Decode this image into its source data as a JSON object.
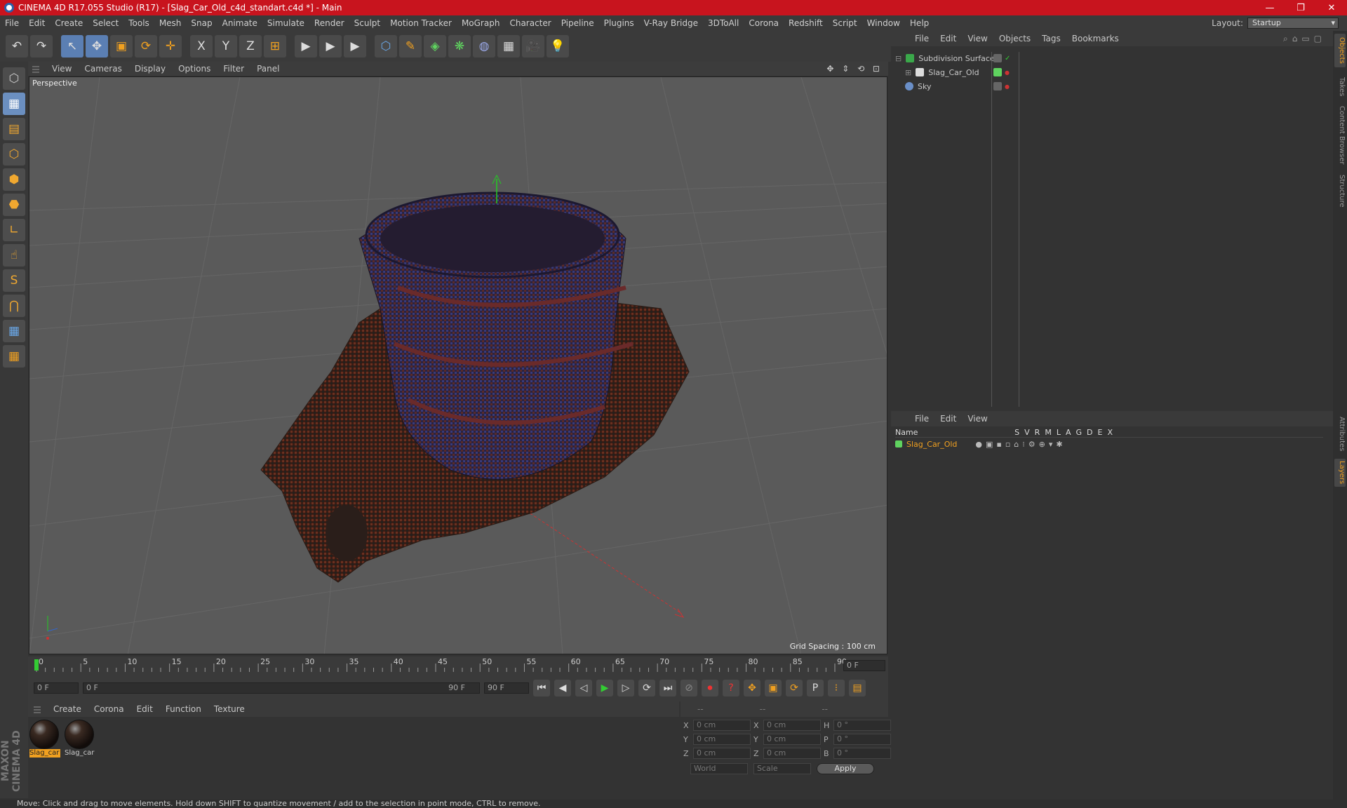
{
  "title_bar": {
    "title": "CINEMA 4D R17.055 Studio (R17) - [Slag_Car_Old_c4d_standart.c4d *] - Main",
    "minimize": "—",
    "maximize": "❐",
    "close": "✕"
  },
  "menu": [
    "File",
    "Edit",
    "Create",
    "Select",
    "Tools",
    "Mesh",
    "Snap",
    "Animate",
    "Simulate",
    "Render",
    "Sculpt",
    "Motion Tracker",
    "MoGraph",
    "Character",
    "Pipeline",
    "Plugins",
    "V-Ray Bridge",
    "3DToAll",
    "Corona",
    "Redshift",
    "Script",
    "Window",
    "Help"
  ],
  "layout": {
    "label": "Layout:",
    "value": "Startup"
  },
  "viewport": {
    "menu": [
      "View",
      "Cameras",
      "Display",
      "Options",
      "Filter",
      "Panel"
    ],
    "label": "Perspective",
    "grid_spacing": "Grid Spacing : 100 cm"
  },
  "timeline": {
    "ticks": [
      "0",
      "5",
      "10",
      "15",
      "20",
      "25",
      "30",
      "35",
      "40",
      "45",
      "50",
      "55",
      "60",
      "65",
      "70",
      "75",
      "80",
      "85",
      "90"
    ],
    "current_frame": "0 F",
    "start_field": "0 F",
    "range_start": "0 F",
    "range_end": "90 F",
    "end_field": "90 F"
  },
  "materials": {
    "menu": [
      "Create",
      "Corona",
      "Edit",
      "Function",
      "Texture"
    ],
    "items": [
      {
        "label": "Slag_car"
      },
      {
        "label": "Slag_car"
      }
    ]
  },
  "coords": {
    "headers": [
      "--",
      "--",
      "--"
    ],
    "rows": [
      {
        "a": "X",
        "av": "0 cm",
        "b": "X",
        "bv": "0 cm",
        "c": "H",
        "cv": "0 °"
      },
      {
        "a": "Y",
        "av": "0 cm",
        "b": "Y",
        "bv": "0 cm",
        "c": "P",
        "cv": "0 °"
      },
      {
        "a": "Z",
        "av": "0 cm",
        "b": "Z",
        "bv": "0 cm",
        "c": "B",
        "cv": "0 °"
      }
    ],
    "world": "World",
    "scale": "Scale",
    "apply": "Apply"
  },
  "objects": {
    "menu": [
      "File",
      "Edit",
      "View",
      "Objects",
      "Tags",
      "Bookmarks"
    ],
    "items": [
      {
        "name": "Subdivision Surface",
        "color": "#3aa84a"
      },
      {
        "name": "Slag_Car_Old",
        "color": "#dddddd"
      },
      {
        "name": "Sky",
        "color": "#6a8fc8"
      }
    ]
  },
  "layers": {
    "menu": [
      "File",
      "Edit",
      "View"
    ],
    "name_header": "Name",
    "columns": [
      "S",
      "V",
      "R",
      "M",
      "L",
      "A",
      "G",
      "D",
      "E",
      "X"
    ],
    "row": "Slag_Car_Old",
    "row_color": "#5fd35f"
  },
  "right_tabs": [
    "Objects",
    "Takes",
    "Content Browser",
    "Structure",
    "Attributes",
    "Layers"
  ],
  "status": "Move: Click and drag to move elements. Hold down SHIFT to quantize movement / add to the selection in point mode, CTRL to remove.",
  "maxon": "MAXON CINEMA 4D",
  "toolbar_icons": {
    "undo": "↶",
    "redo": "↷",
    "select": "↖",
    "move": "✥",
    "scale": "▣",
    "rotate": "⟳",
    "last": "✛",
    "x": "X",
    "y": "Y",
    "z": "Z",
    "coord": "⊞",
    "render1": "▶",
    "render2": "▶",
    "render3": "▶",
    "cube": "⬡",
    "pen": "✎",
    "subdiv": "◈",
    "clone": "❋",
    "deform": "◍",
    "floor": "▦",
    "camera": "🎥",
    "light": "💡"
  },
  "left_icons": [
    "⬡",
    "▦",
    "▤",
    "⬡",
    "⬢",
    "⬣",
    "∟",
    "☝",
    "S",
    "⋂",
    "▦",
    "▦"
  ],
  "play_icons": [
    "⏮",
    "◀",
    "◁",
    "▶",
    "▷",
    "⟳",
    "⏭"
  ],
  "key_icons": [
    "⊘",
    "⏺",
    "?",
    "✥",
    "▣",
    "⟳",
    "P",
    "⁝",
    "▤"
  ]
}
